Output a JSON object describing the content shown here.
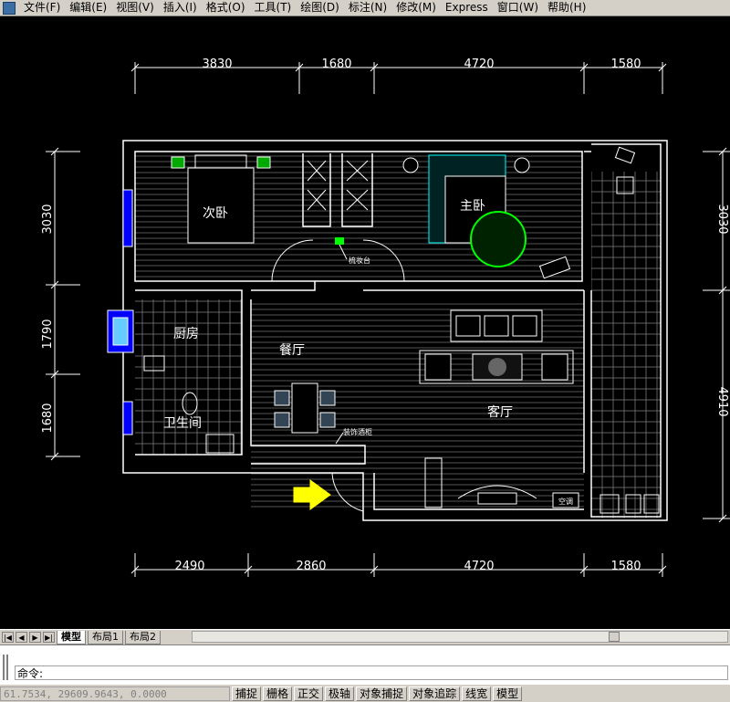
{
  "menu": {
    "items": [
      "文件(F)",
      "编辑(E)",
      "视图(V)",
      "插入(I)",
      "格式(O)",
      "工具(T)",
      "绘图(D)",
      "标注(N)",
      "修改(M)",
      "Express",
      "窗口(W)",
      "帮助(H)"
    ]
  },
  "drawing": {
    "dims_top": [
      "3830",
      "1680",
      "4720",
      "1580"
    ],
    "dims_bottom": [
      "2490",
      "2860",
      "4720",
      "1580"
    ],
    "dims_left": [
      "3030",
      "1790",
      "1680"
    ],
    "dims_right": [
      "3030",
      "4910"
    ],
    "rooms": {
      "second_bedroom": "次卧",
      "master_bedroom": "主卧",
      "kitchen": "厨房",
      "bathroom": "卫生间",
      "dining": "餐厅",
      "living": "客厅"
    },
    "notes": {
      "dresser": "梳妆台",
      "wine_cabinet": "装饰酒柜",
      "aircon": "空调"
    },
    "colors": {
      "wall": "#ffffff",
      "dimension": "#ffffff",
      "green_plant": "#00ff00",
      "cyan_bed": "#00ffff",
      "blue_window": "#0000ff",
      "entry_arrow": "#ffff00",
      "hatch": "#666666"
    }
  },
  "layout_tabs": {
    "items": [
      "模型",
      "布局1",
      "布局2"
    ],
    "active": "模型"
  },
  "command": {
    "prompt": "命令:"
  },
  "status": {
    "coordinates": "61.7534,    29609.9643,  0.0000",
    "buttons": [
      "捕捉",
      "栅格",
      "正交",
      "极轴",
      "对象捕捉",
      "对象追踪",
      "线宽",
      "模型"
    ]
  }
}
